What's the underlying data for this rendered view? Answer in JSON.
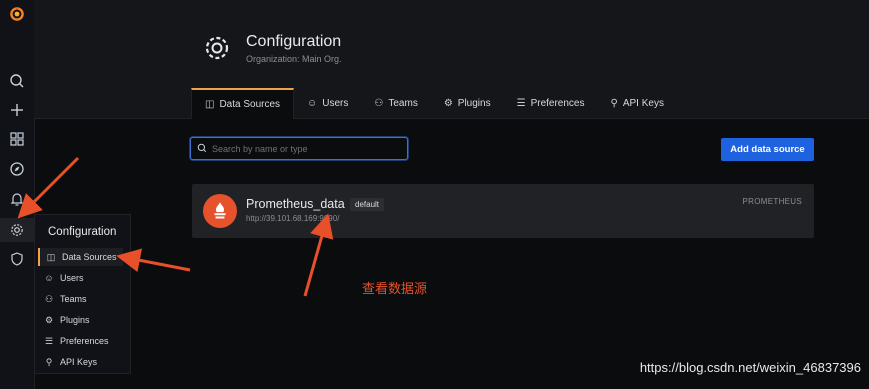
{
  "page": {
    "title": "Configuration",
    "subtitle": "Organization: Main Org."
  },
  "tabs": [
    {
      "label": "Data Sources",
      "icon": "database-icon",
      "active": true
    },
    {
      "label": "Users",
      "icon": "user-icon"
    },
    {
      "label": "Teams",
      "icon": "users-icon"
    },
    {
      "label": "Plugins",
      "icon": "plug-icon"
    },
    {
      "label": "Preferences",
      "icon": "sliders-icon"
    },
    {
      "label": "API Keys",
      "icon": "key-icon"
    }
  ],
  "search": {
    "placeholder": "Search by name or type"
  },
  "add_button": {
    "label": "Add data source"
  },
  "datasource": {
    "name": "Prometheus_data",
    "badge": "default",
    "url": "http://39.101.68.169:9090/",
    "type": "PROMETHEUS"
  },
  "menu": {
    "header": "Configuration",
    "items": [
      {
        "label": "Data Sources",
        "icon": "database-icon",
        "active": true
      },
      {
        "label": "Users",
        "icon": "user-icon"
      },
      {
        "label": "Teams",
        "icon": "users-icon"
      },
      {
        "label": "Plugins",
        "icon": "plug-icon"
      },
      {
        "label": "Preferences",
        "icon": "sliders-icon"
      },
      {
        "label": "API Keys",
        "icon": "key-icon"
      }
    ]
  },
  "annotation": "查看数据源",
  "watermark": "https://blog.csdn.net/weixin_46837396",
  "colors": {
    "accent": "#f2a24c",
    "primary": "#1f62e0",
    "annotation": "#e8502a",
    "prometheus": "#e6522c"
  }
}
